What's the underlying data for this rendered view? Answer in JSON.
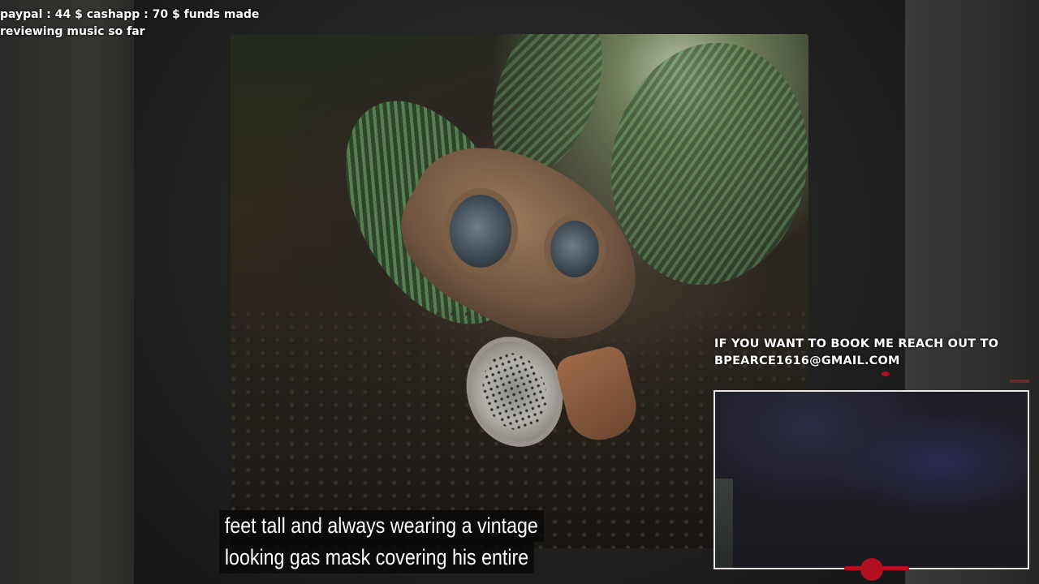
{
  "overlay": {
    "funds_line1": "paypal : 44 $  cashapp : 70 $ funds made",
    "funds_line2": "reviewing music so far",
    "booking_line1": "IF YOU WANT TO BOOK ME REACH OUT TO",
    "booking_line2": "BPEARCE1616@GMAIL.COM"
  },
  "caption": {
    "line1": "feet tall and always wearing a vintage",
    "line2": "looking gas mask covering his entire"
  },
  "image": {
    "subject": "gas-mask-on-forest-floor"
  },
  "colors": {
    "accent_red": "#b01020",
    "webcam_border": "#ece6e6"
  }
}
